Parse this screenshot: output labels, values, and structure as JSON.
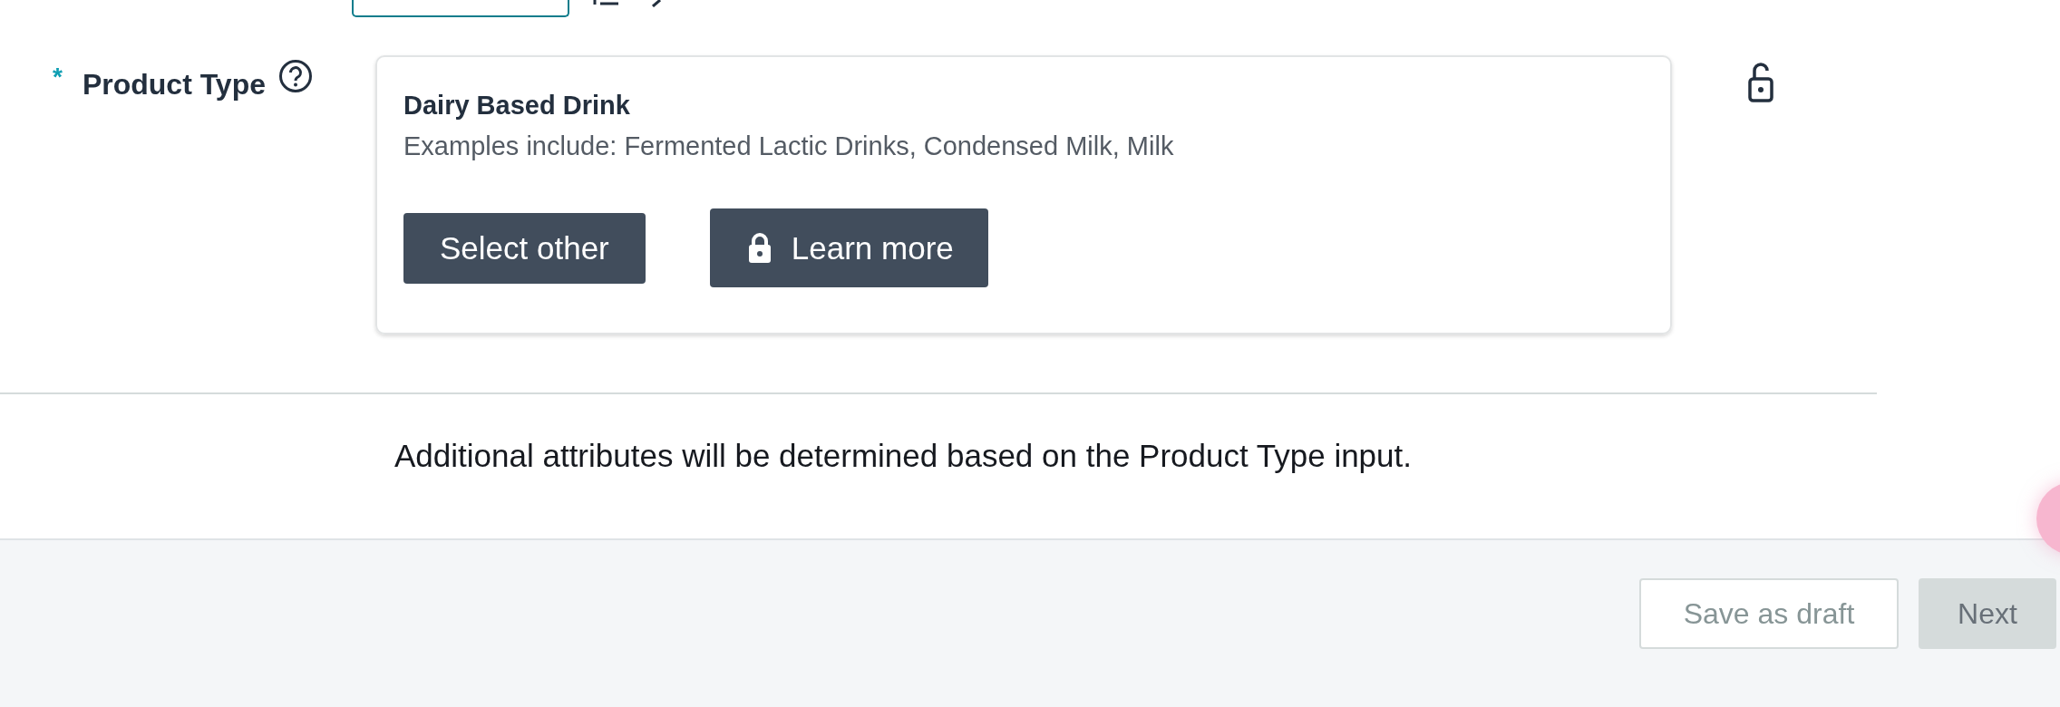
{
  "field": {
    "required_mark": "*",
    "label": "Product Type",
    "locked": false
  },
  "product_card": {
    "title": "Dairy Based Drink",
    "description": "Examples include: Fermented Lactic Drinks, Condensed Milk, Milk",
    "buttons": [
      {
        "label": "Select other",
        "locked": false
      },
      {
        "label": "Learn more",
        "locked": true
      }
    ]
  },
  "info_text": "Additional attributes will be determined based on the Product Type input.",
  "footer": {
    "buttons": [
      {
        "label": "Save as draft",
        "kind": "secondary",
        "disabled": true
      },
      {
        "label": "Next",
        "kind": "primary",
        "disabled": true
      }
    ]
  }
}
